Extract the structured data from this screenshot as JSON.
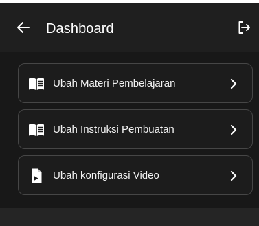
{
  "app_bar": {
    "title": "Dashboard",
    "back_icon": "arrow-left-icon",
    "logout_icon": "logout-icon"
  },
  "menu": {
    "items": [
      {
        "label": "Ubah Materi Pembelajaran",
        "icon": "book-open-icon"
      },
      {
        "label": "Ubah Instruksi Pembuatan",
        "icon": "book-open-icon"
      },
      {
        "label": "Ubah konfigurasi Video",
        "icon": "video-file-icon"
      }
    ],
    "chevron_icon": "chevron-right-icon"
  },
  "colors": {
    "background": "#181818",
    "app_bar": "#1f1f1f",
    "card_border": "#464646",
    "text": "#ffffff"
  }
}
